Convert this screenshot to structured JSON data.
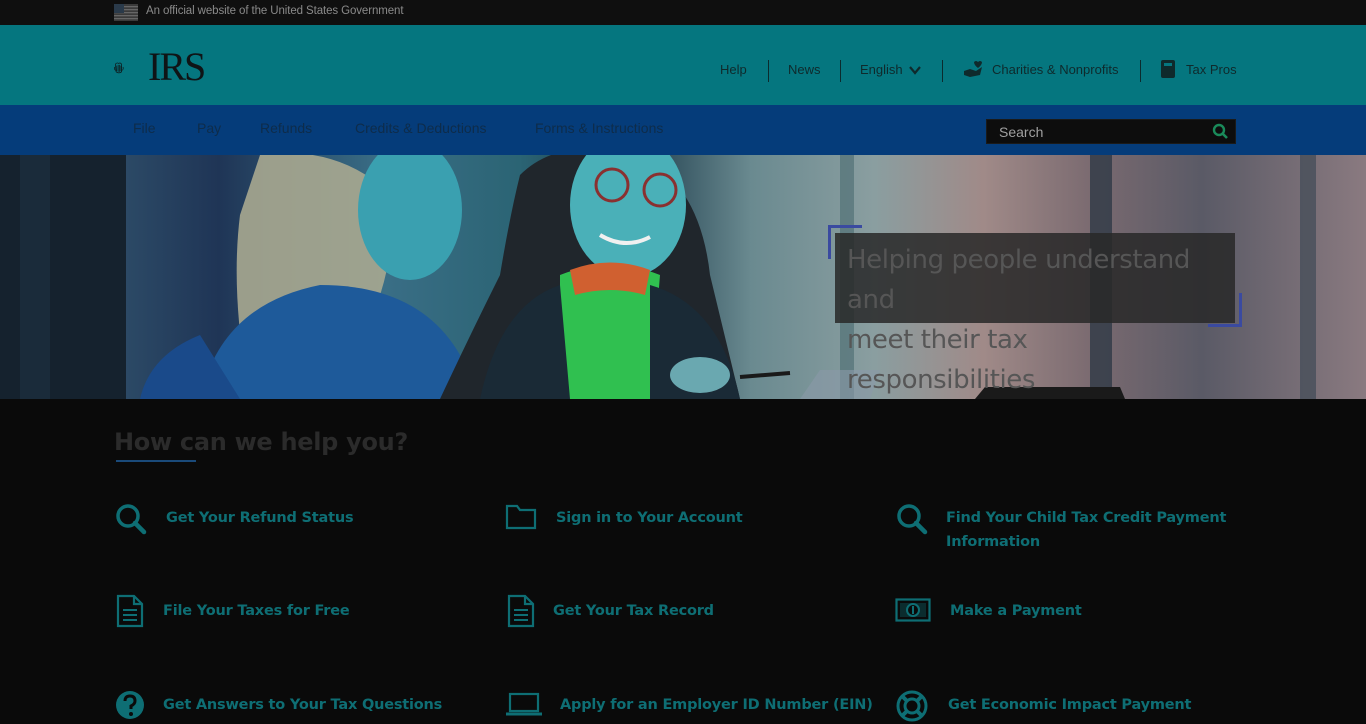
{
  "gov_banner": {
    "text": "An official website of the United States Government"
  },
  "header": {
    "logo_text": "IRS",
    "util_links": {
      "help": "Help",
      "news": "News",
      "language": "English",
      "charities": "Charities & Nonprofits",
      "tax_pros": "Tax Pros"
    }
  },
  "mainnav": {
    "items": [
      "File",
      "Pay",
      "Refunds",
      "Credits & Deductions",
      "Forms & Instructions"
    ],
    "search_placeholder": "Search"
  },
  "hero": {
    "caption_line1": "Helping people understand and",
    "caption_line2": "meet their tax responsibilities"
  },
  "help": {
    "title": "How can we help you?",
    "tasks": [
      {
        "label": "Get Your Refund Status",
        "icon": "search-icon"
      },
      {
        "label": "Sign in to Your Account",
        "icon": "folder-icon"
      },
      {
        "label_line1": "Find Your Child Tax Credit Payment",
        "label_line2": "Information",
        "icon": "search-icon"
      },
      {
        "label": "File Your Taxes for Free",
        "icon": "document-icon"
      },
      {
        "label": "Get Your Tax Record",
        "icon": "document-icon"
      },
      {
        "label": "Make a Payment",
        "icon": "money-icon"
      },
      {
        "label": "Get Answers to Your Tax Questions",
        "icon": "question-icon"
      },
      {
        "label": "Apply for an Employer ID Number (EIN)",
        "icon": "laptop-icon"
      },
      {
        "label": "Get Economic Impact Payment",
        "icon": "lifebuoy-icon"
      }
    ]
  },
  "colors": {
    "header_bg": "#05767f",
    "nav_bg": "#053c7a",
    "link_teal": "#0e6e74"
  }
}
